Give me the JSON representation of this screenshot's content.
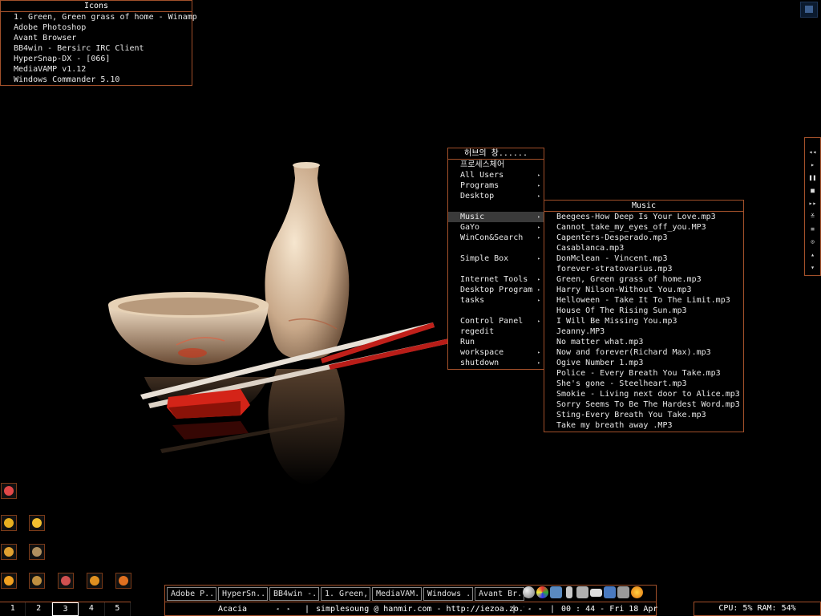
{
  "icons_box": {
    "title": "Icons",
    "items": [
      "1. Green, Green grass of home - Winamp",
      "Adobe Photoshop",
      "Avant Browser",
      "BB4win - Bersirc IRC Client",
      "HyperSnap-DX - [066]",
      "MediaVAMP v1.12",
      "Windows Commander 5.10"
    ]
  },
  "media_bar": {
    "buttons": [
      "◂◂",
      "▸",
      "❚❚",
      "■",
      "▸▸",
      "≚",
      "≡",
      "⊙",
      "▴",
      "▾"
    ]
  },
  "root_menu": {
    "title": "허브의 창......",
    "items": [
      {
        "label": "프로세스체어",
        "arrow": false
      },
      {
        "label": "All Users",
        "arrow": true
      },
      {
        "label": "Programs",
        "arrow": true
      },
      {
        "label": "Desktop",
        "arrow": true
      },
      {
        "label": "",
        "arrow": false
      },
      {
        "label": "Music",
        "arrow": true,
        "selected": true
      },
      {
        "label": "GaYo",
        "arrow": true
      },
      {
        "label": "WinCon&Search",
        "arrow": true
      },
      {
        "label": "",
        "arrow": false
      },
      {
        "label": "Simple Box",
        "arrow": true
      },
      {
        "label": "",
        "arrow": false
      },
      {
        "label": "Internet Tools",
        "arrow": true
      },
      {
        "label": "Desktop Program",
        "arrow": true
      },
      {
        "label": "tasks",
        "arrow": true
      },
      {
        "label": "",
        "arrow": false
      },
      {
        "label": "Control Panel",
        "arrow": true
      },
      {
        "label": "regedit",
        "arrow": false
      },
      {
        "label": "Run",
        "arrow": false
      },
      {
        "label": "workspace",
        "arrow": true
      },
      {
        "label": "shutdown",
        "arrow": true
      }
    ]
  },
  "music_menu": {
    "title": "Music",
    "items": [
      "Beegees-How Deep Is Your Love.mp3",
      "Cannot_take_my_eyes_off_you.MP3",
      "Capenters-Desperado.mp3",
      "Casablanca.mp3",
      "DonMclean - Vincent.mp3",
      "forever-stratovarius.mp3",
      "Green, Green grass of home.mp3",
      "Harry Nilson-Without You.mp3",
      "Helloween - Take It To The Limit.mp3",
      "House Of The Rising Sun.mp3",
      "I Will Be Missing You.mp3",
      "Jeanny.MP3",
      "No matter what.mp3",
      "Now and forever(Richard Max).mp3",
      "Ogive Number 1.mp3",
      "Police - Every Breath You Take.mp3",
      "She's gone - Steelheart.mp3",
      "Smokie - Living next door to Alice.mp3",
      "Sorry Seems To Be The Hardest Word.mp3",
      "Sting-Every Breath You Take.mp3",
      "Take my breath away .MP3"
    ]
  },
  "pager": {
    "workspaces": [
      "1",
      "2",
      "3",
      "4",
      "5"
    ],
    "current": "3"
  },
  "taskbar": {
    "tasks": [
      "Adobe P...",
      "HyperSn...",
      "BB4win -...",
      "1. Green,...",
      "MediaVAM...",
      "Windows ...",
      "Avant Br..."
    ],
    "workspace_name": "Acacia",
    "ticker": "simplesoung @  hanmir.com - http://iezoa.zo.to",
    "clock": "00 : 44  -  Fri 18 Apr"
  },
  "cpu": {
    "text": "CPU: 5% RAM: 54%"
  },
  "colors": {
    "border_accent": "#a2502a",
    "menu_selected": "#3a3a3a"
  }
}
